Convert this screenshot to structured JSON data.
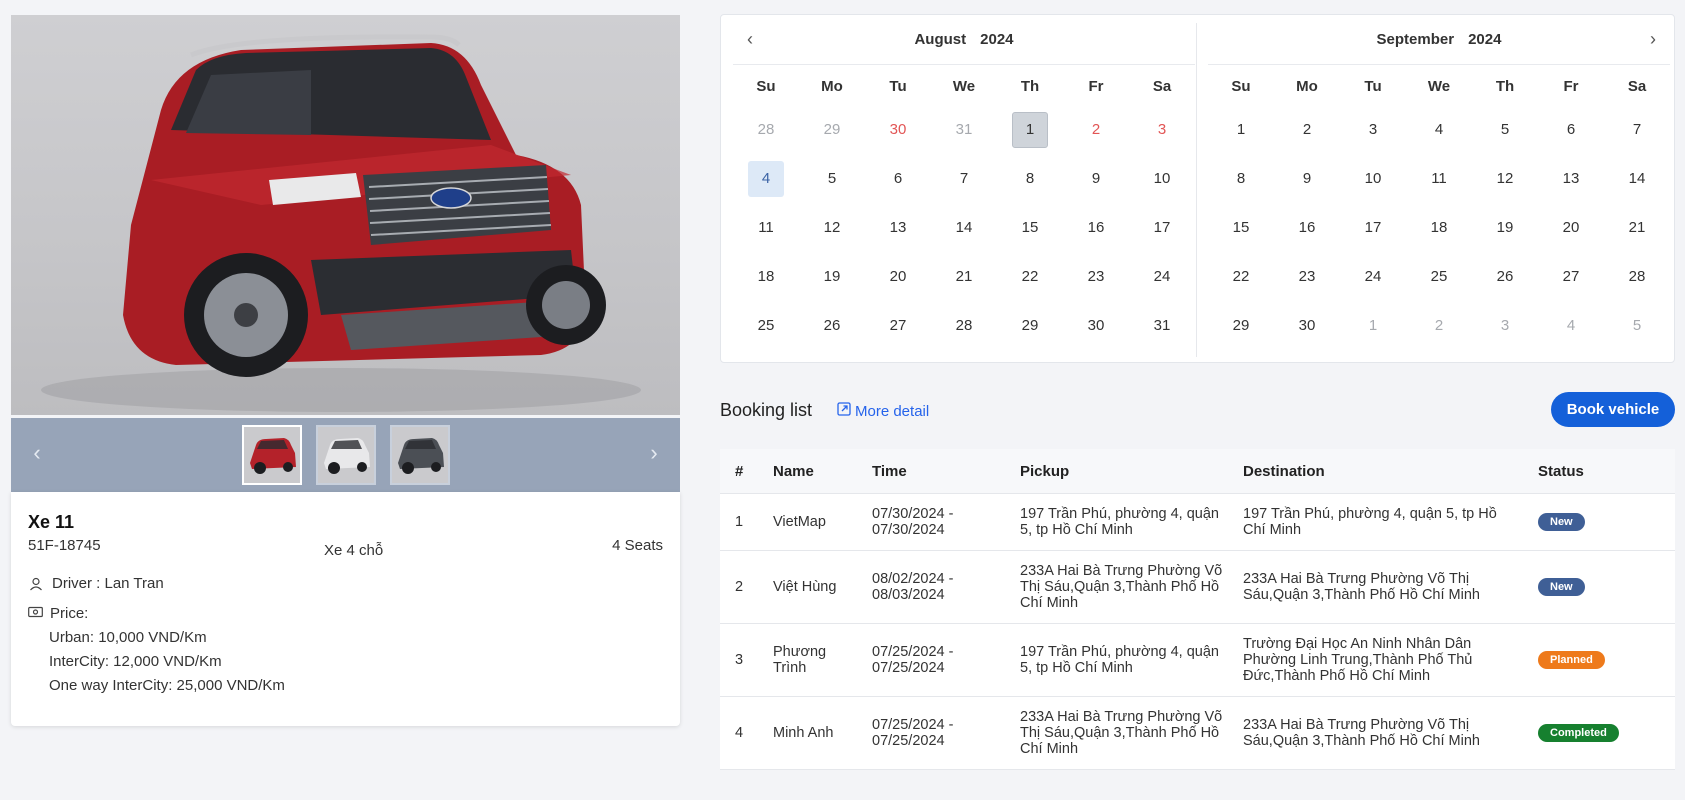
{
  "vehicle": {
    "name": "Xe 11",
    "plate": "51F-18745",
    "type": "Xe 4 chỗ",
    "seats": "4 Seats",
    "driver": "Driver : Lan Tran",
    "price_label": "Price:",
    "prices": [
      "Urban: 10,000 VND/Km",
      "InterCity: 12,000 VND/Km",
      "One way InterCity: 25,000 VND/Km"
    ]
  },
  "gallery": {
    "prev": "‹",
    "next": "›",
    "thumbs": [
      {
        "name": "red-suv",
        "color": "#b4222a"
      },
      {
        "name": "white-mpv",
        "color": "#e8e8ea"
      },
      {
        "name": "grey-suv",
        "color": "#4b4f55"
      }
    ]
  },
  "calendar": {
    "prev": "‹",
    "next": "›",
    "weekdays": [
      "Su",
      "Mo",
      "Tu",
      "We",
      "Th",
      "Fr",
      "Sa"
    ],
    "months": [
      {
        "month": "August",
        "year": "2024",
        "days": [
          {
            "d": "28",
            "s": "muted"
          },
          {
            "d": "29",
            "s": "muted"
          },
          {
            "d": "30",
            "s": "holiday"
          },
          {
            "d": "31",
            "s": "muted"
          },
          {
            "d": "1",
            "s": "selected"
          },
          {
            "d": "2",
            "s": "holiday"
          },
          {
            "d": "3",
            "s": "holiday"
          },
          {
            "d": "4",
            "s": "today"
          },
          {
            "d": "5"
          },
          {
            "d": "6"
          },
          {
            "d": "7"
          },
          {
            "d": "8"
          },
          {
            "d": "9"
          },
          {
            "d": "10"
          },
          {
            "d": "11"
          },
          {
            "d": "12"
          },
          {
            "d": "13"
          },
          {
            "d": "14"
          },
          {
            "d": "15"
          },
          {
            "d": "16"
          },
          {
            "d": "17"
          },
          {
            "d": "18"
          },
          {
            "d": "19"
          },
          {
            "d": "20"
          },
          {
            "d": "21"
          },
          {
            "d": "22"
          },
          {
            "d": "23"
          },
          {
            "d": "24"
          },
          {
            "d": "25"
          },
          {
            "d": "26"
          },
          {
            "d": "27"
          },
          {
            "d": "28"
          },
          {
            "d": "29"
          },
          {
            "d": "30"
          },
          {
            "d": "31"
          }
        ]
      },
      {
        "month": "September",
        "year": "2024",
        "days": [
          {
            "d": "1"
          },
          {
            "d": "2"
          },
          {
            "d": "3"
          },
          {
            "d": "4"
          },
          {
            "d": "5"
          },
          {
            "d": "6"
          },
          {
            "d": "7"
          },
          {
            "d": "8"
          },
          {
            "d": "9"
          },
          {
            "d": "10"
          },
          {
            "d": "11"
          },
          {
            "d": "12"
          },
          {
            "d": "13"
          },
          {
            "d": "14"
          },
          {
            "d": "15"
          },
          {
            "d": "16"
          },
          {
            "d": "17"
          },
          {
            "d": "18"
          },
          {
            "d": "19"
          },
          {
            "d": "20"
          },
          {
            "d": "21"
          },
          {
            "d": "22"
          },
          {
            "d": "23"
          },
          {
            "d": "24"
          },
          {
            "d": "25"
          },
          {
            "d": "26"
          },
          {
            "d": "27"
          },
          {
            "d": "28"
          },
          {
            "d": "29"
          },
          {
            "d": "30"
          },
          {
            "d": "1",
            "s": "muted"
          },
          {
            "d": "2",
            "s": "muted"
          },
          {
            "d": "3",
            "s": "muted"
          },
          {
            "d": "4",
            "s": "muted"
          },
          {
            "d": "5",
            "s": "muted"
          }
        ]
      }
    ]
  },
  "booking": {
    "title": "Booking list",
    "more": "More detail",
    "book_button": "Book vehicle",
    "columns": [
      "#",
      "Name",
      "Time",
      "Pickup",
      "Destination",
      "Status"
    ],
    "rows": [
      {
        "no": "1",
        "name": "VietMap",
        "time": "07/30/2024 - 07/30/2024",
        "pickup": "197 Trần Phú, phường 4, quận 5, tp Hồ Chí Minh",
        "destination": "197 Trần Phú, phường 4, quận 5, tp Hồ Chí Minh",
        "status": "New",
        "status_color": "#3f5f96"
      },
      {
        "no": "2",
        "name": "Việt Hùng",
        "time": "08/02/2024 - 08/03/2024",
        "pickup": "233A Hai Bà Trưng Phường Võ Thị Sáu,Quận 3,Thành Phố Hồ Chí Minh",
        "destination": "233A Hai Bà Trưng Phường Võ Thị Sáu,Quận 3,Thành Phố Hồ Chí Minh",
        "status": "New",
        "status_color": "#3f5f96"
      },
      {
        "no": "3",
        "name": "Phương Trình",
        "time": "07/25/2024 - 07/25/2024",
        "pickup": "197 Trần Phú, phường 4, quận 5, tp Hồ Chí Minh",
        "destination": "Trường Đại Học An Ninh Nhân Dân Phường Linh Trung,Thành Phố Thủ Đức,Thành Phố Hồ Chí Minh",
        "status": "Planned",
        "status_color": "#ee7a1b"
      },
      {
        "no": "4",
        "name": "Minh Anh",
        "time": "07/25/2024 - 07/25/2024",
        "pickup": "233A Hai Bà Trưng Phường Võ Thị Sáu,Quận 3,Thành Phố Hồ Chí Minh",
        "destination": "233A Hai Bà Trưng Phường Võ Thị Sáu,Quận 3,Thành Phố Hồ Chí Minh",
        "status": "Completed",
        "status_color": "#16802f"
      }
    ]
  }
}
